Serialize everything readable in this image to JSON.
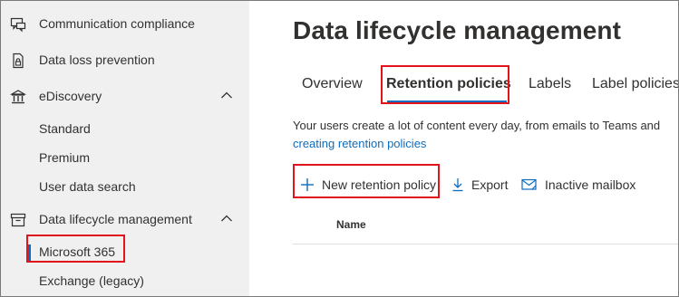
{
  "sidebar": {
    "items": [
      {
        "label": "Communication compliance",
        "icon": "communication-compliance-icon"
      },
      {
        "label": "Data loss prevention",
        "icon": "data-loss-prevention-icon"
      },
      {
        "label": "eDiscovery",
        "icon": "ediscovery-icon",
        "expanded": true
      },
      {
        "label": "Data lifecycle management",
        "icon": "data-lifecycle-icon",
        "expanded": true
      }
    ],
    "ediscovery_children": [
      "Standard",
      "Premium",
      "User data search"
    ],
    "dlm_children": [
      {
        "label": "Microsoft 365",
        "selected": true
      },
      {
        "label": "Exchange (legacy)",
        "selected": false
      }
    ]
  },
  "main": {
    "title": "Data lifecycle management",
    "tabs": [
      {
        "label": "Overview",
        "active": false
      },
      {
        "label": "Retention policies",
        "active": true
      },
      {
        "label": "Labels",
        "active": false
      },
      {
        "label": "Label policies",
        "active": false
      }
    ],
    "description": "Your users create a lot of content every day, from emails to Teams and",
    "description_link": "creating retention policies",
    "commands": {
      "new_policy": "New retention policy",
      "export": "Export",
      "inactive_mailbox": "Inactive mailbox"
    },
    "table": {
      "columns": [
        "Name"
      ]
    }
  },
  "colors": {
    "accent": "#0f6cbd",
    "highlight": "#e3131b",
    "sidebar_bg": "#f0f0f0"
  }
}
